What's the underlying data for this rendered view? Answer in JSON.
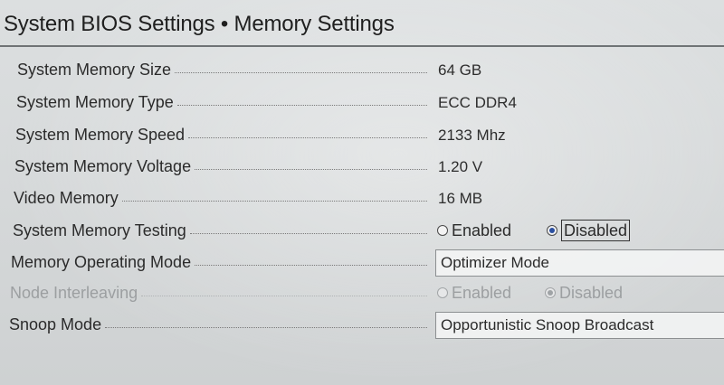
{
  "header": {
    "title": "System BIOS Settings • Memory Settings"
  },
  "settings": [
    {
      "label": "System Memory Size",
      "value": "64 GB"
    },
    {
      "label": "System Memory Type",
      "value": "ECC DDR4"
    },
    {
      "label": "System Memory Speed",
      "value": "2133 Mhz"
    },
    {
      "label": "System Memory Voltage",
      "value": "1.20 V"
    },
    {
      "label": "Video Memory",
      "value": "16 MB"
    },
    {
      "label": "System Memory Testing",
      "options": [
        "Enabled",
        "Disabled"
      ],
      "selected": "Disabled"
    },
    {
      "label": "Memory Operating Mode",
      "value": "Optimizer Mode"
    },
    {
      "label": "Node Interleaving",
      "options": [
        "Enabled",
        "Disabled"
      ],
      "selected": "Disabled",
      "disabled": true
    },
    {
      "label": "Snoop Mode",
      "value": "Opportunistic Snoop Broadcast"
    }
  ]
}
